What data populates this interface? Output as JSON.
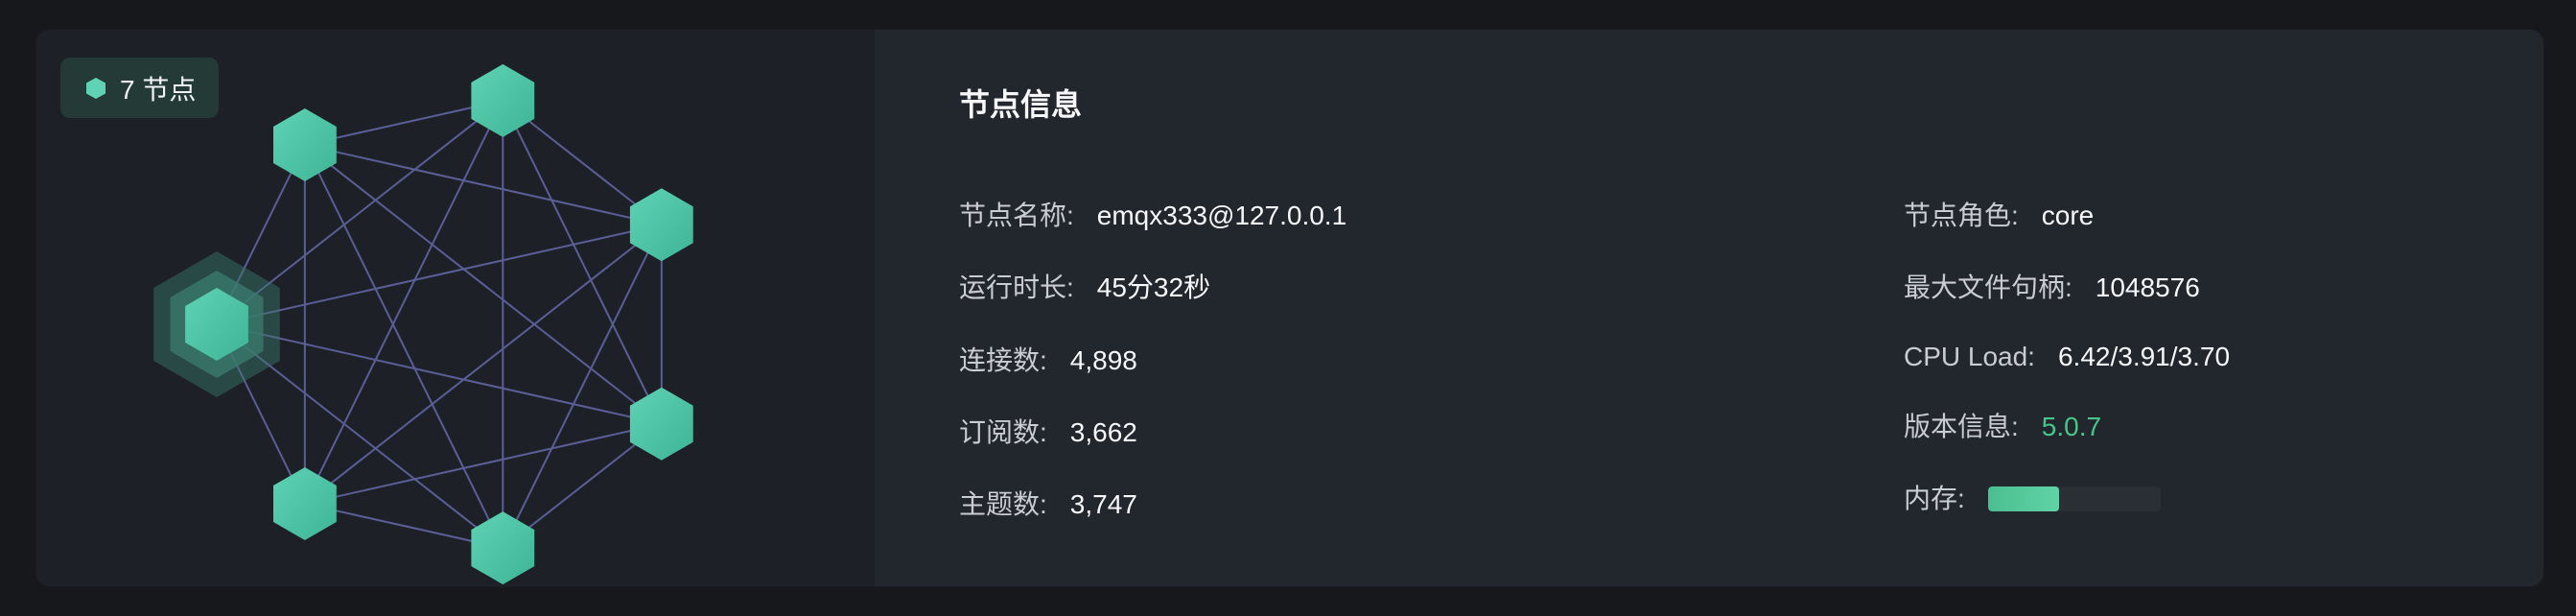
{
  "topology": {
    "node_count_label": "7 节点",
    "colors": {
      "hex": "#5fd3b4",
      "hex_dark": "#3eb596",
      "edge": "#5b5e96",
      "halo": "#3a7a6c"
    }
  },
  "node_info": {
    "title": "节点信息",
    "left": [
      {
        "label": "节点名称:",
        "value": "emqx333@127.0.0.1"
      },
      {
        "label": "运行时长:",
        "value": "45分32秒"
      },
      {
        "label": "连接数:",
        "value": "4,898"
      },
      {
        "label": "订阅数:",
        "value": "3,662"
      },
      {
        "label": "主题数:",
        "value": "3,747"
      }
    ],
    "right": [
      {
        "label": "节点角色:",
        "value": "core"
      },
      {
        "label": "最大文件句柄:",
        "value": "1048576"
      },
      {
        "label": "CPU Load:",
        "value": "6.42/3.91/3.70"
      },
      {
        "label": "版本信息:",
        "value": "5.0.7"
      },
      {
        "label": "内存:",
        "memory_fraction": 0.41
      }
    ],
    "version_color": "#45c68a"
  }
}
